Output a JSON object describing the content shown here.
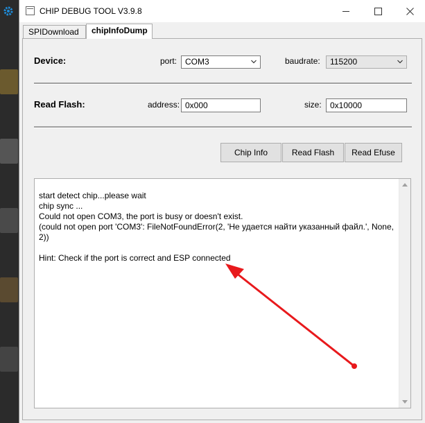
{
  "window": {
    "title": "CHIP DEBUG TOOL V3.9.8"
  },
  "tabs": [
    {
      "label": "SPIDownload"
    },
    {
      "label": "chipInfoDump"
    }
  ],
  "device": {
    "heading": "Device:",
    "port_label": "port:",
    "port_value": "COM3",
    "baudrate_label": "baudrate:",
    "baudrate_value": "115200"
  },
  "read_flash": {
    "heading": "Read Flash:",
    "address_label": "address:",
    "address_value": "0x000",
    "size_label": "size:",
    "size_value": "0x10000"
  },
  "buttons": {
    "chip_info": "Chip Info",
    "read_flash": "Read Flash",
    "read_efuse": "Read Efuse"
  },
  "log": {
    "text": "start detect chip...please wait\nchip sync ...\nCould not open COM3, the port is busy or doesn't exist.\n(could not open port 'COM3': FileNotFoundError(2, 'Не удается найти указанный файл.', None,\n2))\n\nHint: Check if the port is correct and ESP connected"
  },
  "colors": {
    "annotation_arrow": "#e8191c",
    "desktop_gear": "#1e8ad6"
  },
  "icons": [
    "app-icon",
    "minimize-icon",
    "maximize-icon",
    "close-icon",
    "chevron-down-icon",
    "scroll-up-icon",
    "scroll-down-icon",
    "gear-icon"
  ]
}
